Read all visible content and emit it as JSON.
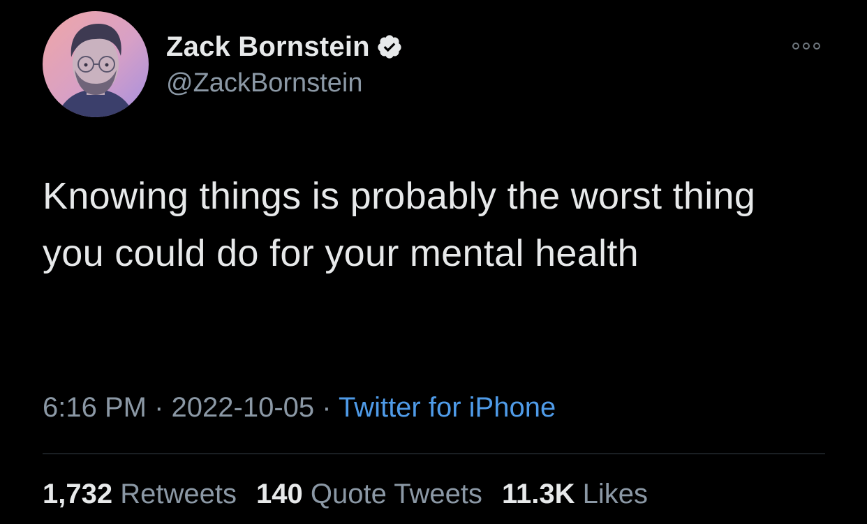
{
  "author": {
    "display_name": "Zack Bornstein",
    "handle": "@ZackBornstein",
    "verified": true,
    "avatar_icon": "user-avatar-photo",
    "verified_icon": "verified-badge-icon"
  },
  "menu": {
    "more_icon": "more-horizontal-icon"
  },
  "tweet": {
    "text": "Knowing things is probably the worst thing you could do for your mental health",
    "time": "6:16 PM",
    "separator": " · ",
    "date": "2022-10-05",
    "source": "Twitter for iPhone"
  },
  "stats": {
    "retweets_count": "1,732",
    "retweets_label": "Retweets",
    "quotes_count": "140",
    "quotes_label": "Quote Tweets",
    "likes_count": "11.3K",
    "likes_label": "Likes"
  },
  "colors": {
    "background": "#000000",
    "primary_text": "#e7e9ea",
    "secondary_text": "#8b98a5",
    "link": "#4f9be8",
    "divider": "#38444d"
  }
}
